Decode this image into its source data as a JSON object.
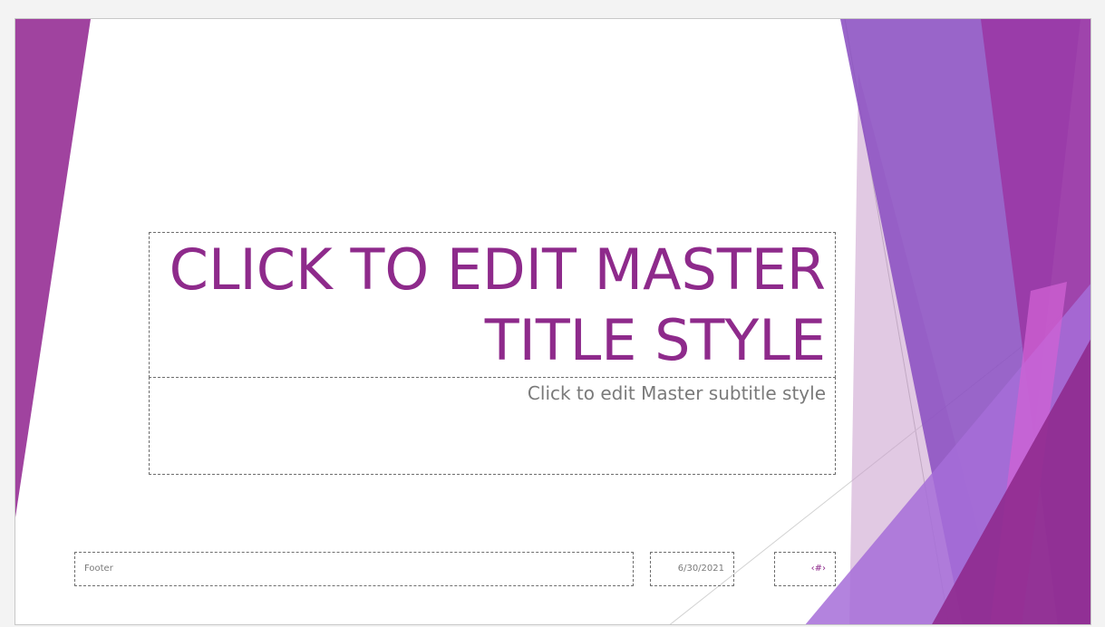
{
  "slide": {
    "title": "Click to edit Master title style",
    "subtitle": "Click to edit Master subtitle style",
    "footer": "Footer",
    "date": "6/30/2021",
    "slide_number": "‹#›"
  },
  "colors": {
    "accent_purple": "#8e2a8b",
    "violet": "#8b58c4",
    "magenta": "#a0369e",
    "text_gray": "#7a7a7a"
  }
}
